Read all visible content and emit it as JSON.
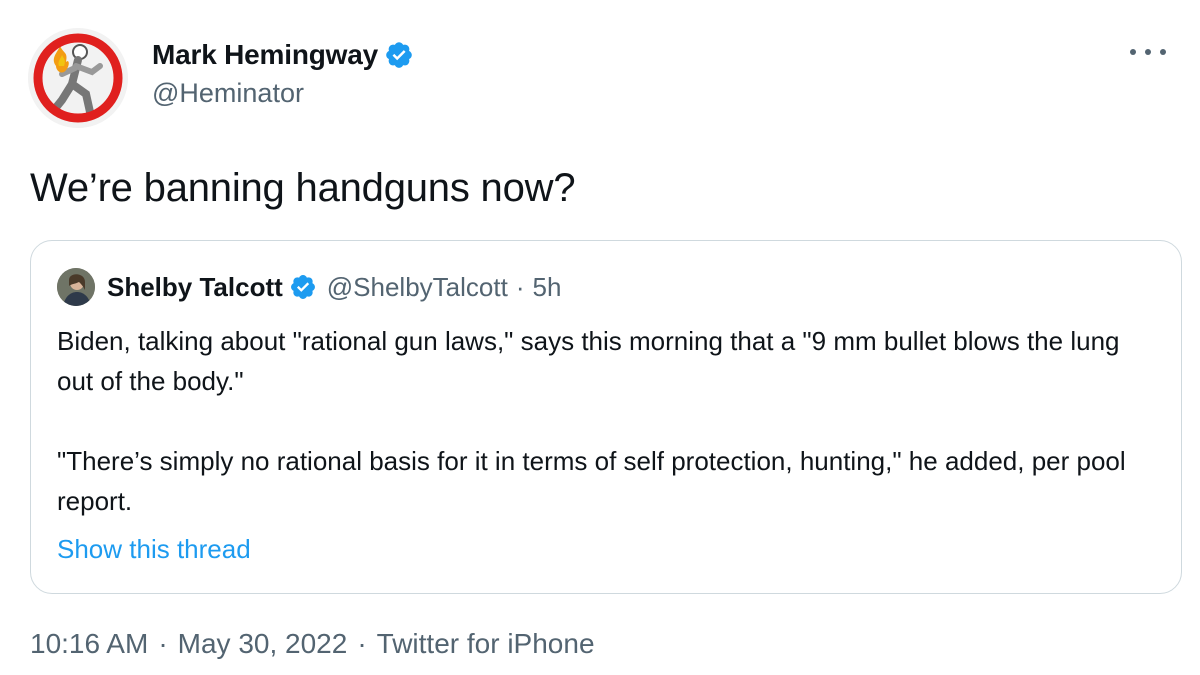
{
  "author": {
    "name": "Mark Hemingway",
    "handle": "@Heminator",
    "verified": true,
    "avatar_icon": "running-man-no-symbol-avatar"
  },
  "more_icon": "more-horizontal-icon",
  "tweet": {
    "text": "We’re banning handguns now?"
  },
  "quoted_tweet": {
    "author_name": "Shelby Talcott",
    "author_handle": "@ShelbyTalcott",
    "separator": "·",
    "time": "5h",
    "verified": true,
    "paragraphs": [
      "Biden, talking about \"rational gun laws,\" says this morning that a \"9 mm bullet blows the lung out of the body.\"",
      "\"There’s simply no rational basis for it in terms of self protection, hunting,\" he added, per pool report."
    ],
    "show_thread_label": "Show this thread"
  },
  "meta": {
    "time": "10:16 AM",
    "separator": "·",
    "date": "May 30, 2022",
    "source": "Twitter for iPhone"
  },
  "colors": {
    "text": "#0f1419",
    "secondary": "#536471",
    "link": "#1d9bf0",
    "verified": "#1d9bf0",
    "border": "#cfd9de"
  }
}
